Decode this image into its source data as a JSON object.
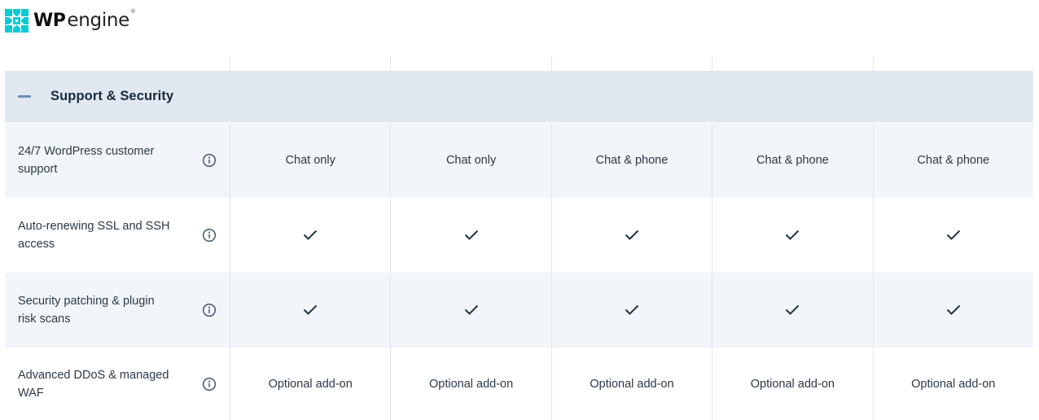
{
  "brand": {
    "logo_wp": "WP",
    "logo_engine": "engine",
    "logo_reg": "®",
    "accent_color": "#0ecad4"
  },
  "section": {
    "title": "Support & Security",
    "toggle_icon": "minus-icon",
    "expanded": true
  },
  "plan_count": 5,
  "rows": [
    {
      "feature": "24/7 WordPress customer support",
      "info_icon": "info-icon",
      "values": [
        {
          "type": "text",
          "text": "Chat only"
        },
        {
          "type": "text",
          "text": "Chat only"
        },
        {
          "type": "text",
          "text": "Chat & phone"
        },
        {
          "type": "text",
          "text": "Chat & phone"
        },
        {
          "type": "text",
          "text": "Chat & phone"
        }
      ]
    },
    {
      "feature": "Auto-renewing SSL and SSH access",
      "info_icon": "info-icon",
      "values": [
        {
          "type": "check",
          "text": "included"
        },
        {
          "type": "check",
          "text": "included"
        },
        {
          "type": "check",
          "text": "included"
        },
        {
          "type": "check",
          "text": "included"
        },
        {
          "type": "check",
          "text": "included"
        }
      ]
    },
    {
      "feature": "Security patching & plugin risk scans",
      "info_icon": "info-icon",
      "values": [
        {
          "type": "check",
          "text": "included"
        },
        {
          "type": "check",
          "text": "included"
        },
        {
          "type": "check",
          "text": "included"
        },
        {
          "type": "check",
          "text": "included"
        },
        {
          "type": "check",
          "text": "included"
        }
      ]
    },
    {
      "feature": "Advanced DDoS & managed WAF",
      "info_icon": "info-icon",
      "values": [
        {
          "type": "text",
          "text": "Optional add-on"
        },
        {
          "type": "text",
          "text": "Optional add-on"
        },
        {
          "type": "text",
          "text": "Optional add-on"
        },
        {
          "type": "text",
          "text": "Optional add-on"
        },
        {
          "type": "text",
          "text": "Optional add-on"
        }
      ]
    }
  ]
}
